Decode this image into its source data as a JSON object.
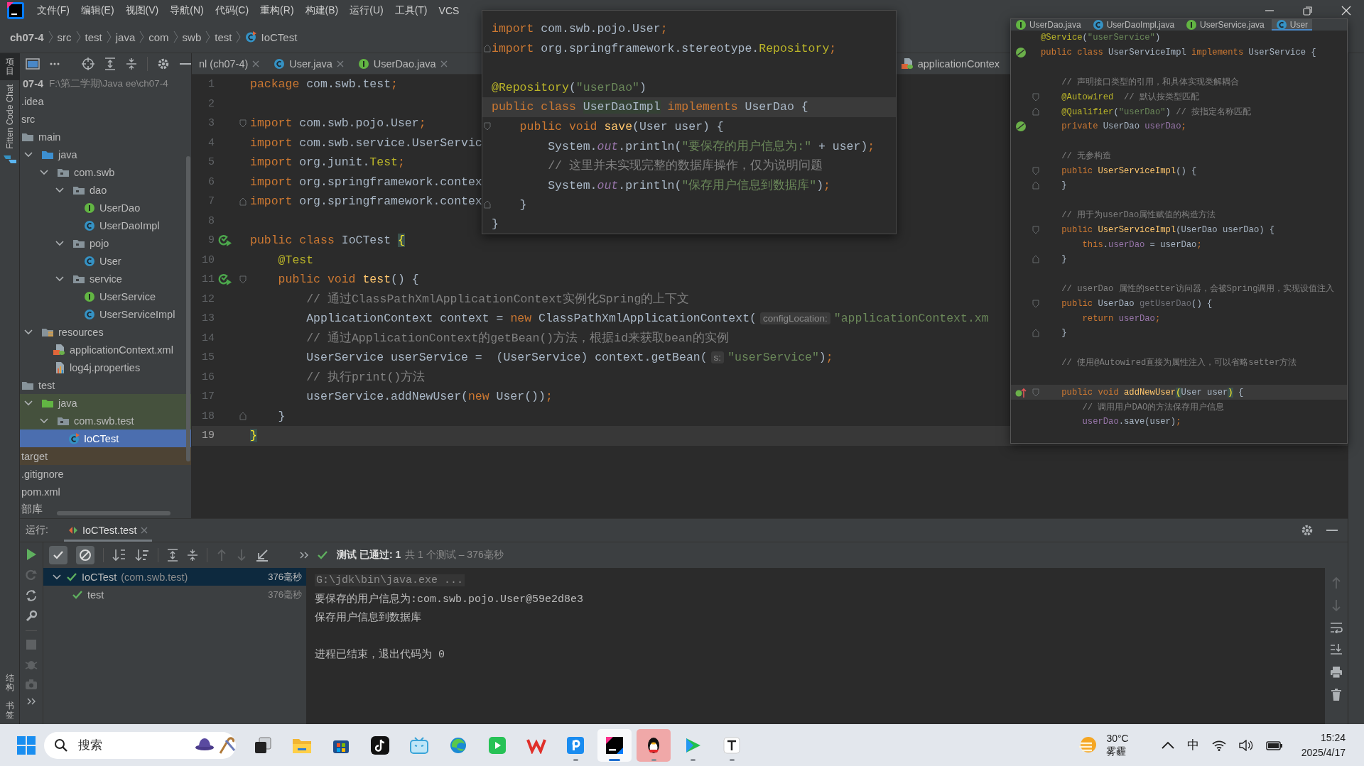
{
  "menu_bar": {
    "items": [
      "文件(F)",
      "编辑(E)",
      "视图(V)",
      "导航(N)",
      "代码(C)",
      "重构(R)",
      "构建(B)",
      "运行(U)",
      "工具(T)",
      "VCS"
    ]
  },
  "breadcrumb": {
    "items": [
      "ch07-4",
      "src",
      "test",
      "java",
      "com",
      "swb",
      "test",
      "IoCTest"
    ]
  },
  "tool_stripe": {
    "top": [
      {
        "label": "项目",
        "kind": "cjk",
        "selected": true
      },
      {
        "label": "Fitten Code Chat",
        "kind": "latin",
        "selected": false
      }
    ],
    "bottom": [
      {
        "label": "结构",
        "kind": "cjk",
        "selected": false
      },
      {
        "label": "书签",
        "kind": "cjk",
        "selected": false
      }
    ]
  },
  "project_panel": {
    "root_name": "07-4",
    "root_path": "F:\\第二学期\\Java ee\\ch07-4",
    "tree": [
      {
        "label": ".idea",
        "selected": false
      },
      {
        "label": "src",
        "selected": false,
        "children": [
          {
            "label": "main",
            "kind": "folder",
            "selected": false,
            "children": [
              {
                "label": "java",
                "kind": "source-folder",
                "expanded": true,
                "selected": false,
                "children": [
                  {
                    "label": "com.swb",
                    "kind": "package",
                    "expanded": true,
                    "selected": false,
                    "children": [
                      {
                        "label": "dao",
                        "kind": "package",
                        "expanded": true,
                        "selected": false,
                        "children": [
                          {
                            "label": "UserDao",
                            "kind": "interface",
                            "selected": false
                          },
                          {
                            "label": "UserDaoImpl",
                            "kind": "class",
                            "selected": false
                          }
                        ]
                      },
                      {
                        "label": "pojo",
                        "kind": "package",
                        "expanded": true,
                        "selected": false,
                        "children": [
                          {
                            "label": "User",
                            "kind": "class",
                            "selected": false
                          }
                        ]
                      },
                      {
                        "label": "service",
                        "kind": "package",
                        "expanded": true,
                        "selected": false,
                        "children": [
                          {
                            "label": "UserService",
                            "kind": "interface",
                            "selected": false
                          },
                          {
                            "label": "UserServiceImpl",
                            "kind": "class",
                            "selected": false
                          }
                        ]
                      }
                    ]
                  }
                ]
              },
              {
                "label": "resources",
                "kind": "resources",
                "expanded": true,
                "selected": false,
                "children": [
                  {
                    "label": "applicationContext.xml",
                    "kind": "xml",
                    "selected": false
                  },
                  {
                    "label": "log4j.properties",
                    "kind": "properties",
                    "selected": false
                  }
                ]
              }
            ]
          },
          {
            "label": "test",
            "kind": "folder",
            "selected": false,
            "children": [
              {
                "label": "java",
                "kind": "test-folder",
                "expanded": true,
                "color": "#45513d",
                "selected": false,
                "children": [
                  {
                    "label": "com.swb.test",
                    "kind": "package",
                    "expanded": true,
                    "color": "#45513d",
                    "selected": false,
                    "children": [
                      {
                        "label": "IoCTest",
                        "kind": "test-class",
                        "selected": true
                      }
                    ]
                  }
                ]
              }
            ]
          }
        ]
      },
      {
        "label": "target",
        "color": "#4d4334",
        "selected": false
      },
      {
        "label": ".gitignore",
        "selected": false
      },
      {
        "label": "pom.xml",
        "selected": false
      },
      {
        "label": "部库",
        "selected": false
      }
    ]
  },
  "editor": {
    "tabs": [
      {
        "label": "nl (ch07-4)",
        "kind": "none",
        "selected": false
      },
      {
        "label": "User.java",
        "kind": "class",
        "selected": false
      },
      {
        "label": "UserDao.java",
        "kind": "interface",
        "selected": false
      },
      {
        "label": "applicationContex",
        "kind": "xml",
        "selected": false
      }
    ],
    "lines": [
      {
        "number": "1",
        "current": false,
        "tokens": [
          {
            "kind": "keyword",
            "text": "package "
          },
          {
            "kind": "plain",
            "text": "com.swb.test"
          },
          {
            "kind": "keyword",
            "text": ";"
          }
        ]
      },
      {
        "number": "2",
        "current": false
      },
      {
        "number": "3",
        "current": false,
        "fold": {
          "kind": "start"
        },
        "tokens": [
          {
            "kind": "keyword",
            "text": "import "
          },
          {
            "kind": "plain",
            "text": "com.swb.pojo.User"
          },
          {
            "kind": "keyword",
            "text": ";"
          }
        ]
      },
      {
        "number": "4",
        "current": false,
        "tokens": [
          {
            "kind": "keyword",
            "text": "import "
          },
          {
            "kind": "plain",
            "text": "com.swb.service.UserServic"
          }
        ]
      },
      {
        "number": "5",
        "current": false,
        "tokens": [
          {
            "kind": "keyword",
            "text": "import "
          },
          {
            "kind": "plain",
            "text": "org.junit."
          },
          {
            "kind": "annotation",
            "text": "Test"
          },
          {
            "kind": "keyword",
            "text": ";"
          }
        ]
      },
      {
        "number": "6",
        "current": false,
        "tokens": [
          {
            "kind": "keyword",
            "text": "import "
          },
          {
            "kind": "plain",
            "text": "org.springframework.contex"
          }
        ]
      },
      {
        "number": "7",
        "current": false,
        "fold": {
          "kind": "end"
        },
        "tokens": [
          {
            "kind": "keyword",
            "text": "import "
          },
          {
            "kind": "plain",
            "text": "org.springframework.contex"
          }
        ]
      },
      {
        "number": "8",
        "current": false
      },
      {
        "number": "9",
        "current": false,
        "gutter": {
          "kind": "run"
        },
        "tokens": [
          {
            "kind": "keyword",
            "text": "public class "
          },
          {
            "kind": "plain",
            "text": "IoCTest "
          },
          {
            "kind": "brace",
            "text": "{"
          }
        ]
      },
      {
        "number": "10",
        "current": false,
        "tokens": [
          {
            "kind": "annotation",
            "text": "    @Test"
          }
        ]
      },
      {
        "number": "11",
        "current": false,
        "gutter": {
          "kind": "run"
        },
        "fold": {
          "kind": "start"
        },
        "tokens": [
          {
            "kind": "keyword",
            "text": "    public void "
          },
          {
            "kind": "method",
            "text": "test"
          },
          {
            "kind": "plain",
            "text": "() {"
          }
        ]
      },
      {
        "number": "12",
        "current": false,
        "tokens": [
          {
            "kind": "comment",
            "text": "        // 通过ClassPathXmlApplicationContext实例化Spring的上下文"
          }
        ]
      },
      {
        "number": "13",
        "current": false,
        "tokens": [
          {
            "kind": "plain",
            "text": "        ApplicationContext context = "
          },
          {
            "kind": "keyword",
            "text": "new "
          },
          {
            "kind": "plain",
            "text": "ClassPathXmlApplicationContext("
          },
          {
            "kind": "hint",
            "text": "configLocation:"
          },
          {
            "kind": "string",
            "text": "\"applicationContext.xm"
          }
        ]
      },
      {
        "number": "14",
        "current": false,
        "tokens": [
          {
            "kind": "comment",
            "text": "        // 通过ApplicationContext的getBean()方法，根据id来获取bean的实例"
          }
        ]
      },
      {
        "number": "15",
        "current": false,
        "tokens": [
          {
            "kind": "plain",
            "text": "        UserService userService =  (UserService) context.getBean("
          },
          {
            "kind": "hint",
            "text": "s:"
          },
          {
            "kind": "string",
            "text": "\"userService\""
          },
          {
            "kind": "plain",
            "text": ")"
          },
          {
            "kind": "keyword",
            "text": ";"
          }
        ]
      },
      {
        "number": "16",
        "current": false,
        "tokens": [
          {
            "kind": "comment",
            "text": "        // 执行print()方法"
          }
        ]
      },
      {
        "number": "17",
        "current": false,
        "tokens": [
          {
            "kind": "plain",
            "text": "        userService.addNewUser("
          },
          {
            "kind": "keyword",
            "text": "new "
          },
          {
            "kind": "plain",
            "text": "User())"
          },
          {
            "kind": "keyword",
            "text": ";"
          }
        ]
      },
      {
        "number": "18",
        "current": false,
        "fold": {
          "kind": "end"
        },
        "tokens": [
          {
            "kind": "plain",
            "text": "    }"
          }
        ]
      },
      {
        "number": "19",
        "current": true,
        "tokens": [
          {
            "kind": "brace",
            "text": "}"
          }
        ]
      }
    ]
  },
  "definition_popup": {
    "lines": [
      {
        "current": false,
        "tokens": [
          {
            "kind": "keyword",
            "text": "import "
          },
          {
            "kind": "plain",
            "text": "com.swb.pojo.User"
          },
          {
            "kind": "keyword",
            "text": ";"
          }
        ]
      },
      {
        "current": false,
        "fold": {
          "kind": "end"
        },
        "tokens": [
          {
            "kind": "keyword",
            "text": "import "
          },
          {
            "kind": "plain",
            "text": "org.springframework.stereotype."
          },
          {
            "kind": "annotation",
            "text": "Repository"
          },
          {
            "kind": "keyword",
            "text": ";"
          }
        ]
      },
      {
        "current": false
      },
      {
        "current": false,
        "tokens": [
          {
            "kind": "annotation",
            "text": "@Repository"
          },
          {
            "kind": "plain",
            "text": "("
          },
          {
            "kind": "string",
            "text": "\"userDao\""
          },
          {
            "kind": "plain",
            "text": ")"
          }
        ]
      },
      {
        "current": true,
        "tokens": [
          {
            "kind": "keyword",
            "text": "public class "
          },
          {
            "kind": "usage",
            "text": "UserDaoImpl"
          },
          {
            "kind": "keyword",
            "text": " implements "
          },
          {
            "kind": "plain",
            "text": "UserDao {"
          }
        ]
      },
      {
        "current": false,
        "fold": {
          "kind": "start"
        },
        "tokens": [
          {
            "kind": "keyword",
            "text": "    public void "
          },
          {
            "kind": "method",
            "text": "save"
          },
          {
            "kind": "plain",
            "text": "(User user) {"
          }
        ]
      },
      {
        "current": false,
        "tokens": [
          {
            "kind": "plain",
            "text": "        System."
          },
          {
            "kind": "static",
            "text": "out"
          },
          {
            "kind": "plain",
            "text": ".println("
          },
          {
            "kind": "string",
            "text": "\"要保存的用户信息为:\""
          },
          {
            "kind": "plain",
            "text": " + user)"
          },
          {
            "kind": "keyword",
            "text": ";"
          }
        ]
      },
      {
        "current": false,
        "tokens": [
          {
            "kind": "comment",
            "text": "        // 这里并未实现完整的数据库操作，仅为说明问题"
          }
        ]
      },
      {
        "current": false,
        "tokens": [
          {
            "kind": "plain",
            "text": "        System."
          },
          {
            "kind": "static",
            "text": "out"
          },
          {
            "kind": "plain",
            "text": ".println("
          },
          {
            "kind": "string",
            "text": "\"保存用户信息到数据库\""
          },
          {
            "kind": "plain",
            "text": ")"
          },
          {
            "kind": "keyword",
            "text": ";"
          }
        ]
      },
      {
        "current": false,
        "fold": {
          "kind": "end"
        },
        "tokens": [
          {
            "kind": "plain",
            "text": "    }"
          }
        ]
      },
      {
        "current": false,
        "tokens": [
          {
            "kind": "plain",
            "text": "}"
          }
        ]
      }
    ]
  },
  "side_window": {
    "tabs": [
      {
        "label": "UserDao.java",
        "kind": "interface",
        "selected": false
      },
      {
        "label": "UserDaoImpl.java",
        "kind": "class",
        "selected": false
      },
      {
        "label": "UserService.java",
        "kind": "interface",
        "selected": false
      },
      {
        "label": "User",
        "kind": "class",
        "selected": true
      }
    ],
    "lines": [
      {
        "current": false,
        "tokens": [
          {
            "kind": "annotation",
            "text": "@Service"
          },
          {
            "kind": "plain",
            "text": "("
          },
          {
            "kind": "string",
            "text": "\"userService\""
          },
          {
            "kind": "plain",
            "text": ")"
          }
        ]
      },
      {
        "current": false,
        "gutter": {
          "kind": "bean"
        },
        "tokens": [
          {
            "kind": "keyword",
            "text": "public class "
          },
          {
            "kind": "plain",
            "text": "UserServiceImpl "
          },
          {
            "kind": "keyword",
            "text": "implements "
          },
          {
            "kind": "plain",
            "text": "UserService {"
          }
        ]
      },
      {
        "current": false
      },
      {
        "current": false,
        "tokens": [
          {
            "kind": "comment",
            "text": "    // 声明接口类型的引用，和具体实现类解耦合"
          }
        ]
      },
      {
        "current": false,
        "fold": {
          "kind": "start"
        },
        "tokens": [
          {
            "kind": "annotation",
            "text": "    @Autowired"
          },
          {
            "kind": "comment",
            "text": "  // 默认按类型匹配"
          }
        ]
      },
      {
        "current": false,
        "fold": {
          "kind": "end"
        },
        "tokens": [
          {
            "kind": "annotation",
            "text": "    @Qualifier"
          },
          {
            "kind": "plain",
            "text": "("
          },
          {
            "kind": "string",
            "text": "\"userDao\""
          },
          {
            "kind": "plain",
            "text": ")"
          },
          {
            "kind": "comment",
            "text": " // 按指定名称匹配"
          }
        ]
      },
      {
        "current": false,
        "gutter": {
          "kind": "bean"
        },
        "tokens": [
          {
            "kind": "keyword",
            "text": "    private "
          },
          {
            "kind": "plain",
            "text": "UserDao "
          },
          {
            "kind": "field",
            "text": "userDao"
          },
          {
            "kind": "keyword",
            "text": ";"
          }
        ]
      },
      {
        "current": false
      },
      {
        "current": false,
        "tokens": [
          {
            "kind": "comment",
            "text": "    // 无参构造"
          }
        ]
      },
      {
        "current": false,
        "fold": {
          "kind": "start"
        },
        "tokens": [
          {
            "kind": "keyword",
            "text": "    public "
          },
          {
            "kind": "method",
            "text": "UserServiceImpl"
          },
          {
            "kind": "plain",
            "text": "() {"
          }
        ]
      },
      {
        "current": false,
        "fold": {
          "kind": "end"
        },
        "tokens": [
          {
            "kind": "plain",
            "text": "    }"
          }
        ]
      },
      {
        "current": false
      },
      {
        "current": false,
        "tokens": [
          {
            "kind": "comment",
            "text": "    // 用于为userDao属性赋值的构造方法"
          }
        ]
      },
      {
        "current": false,
        "fold": {
          "kind": "start"
        },
        "tokens": [
          {
            "kind": "keyword",
            "text": "    public "
          },
          {
            "kind": "method",
            "text": "UserServiceImpl"
          },
          {
            "kind": "plain",
            "text": "(UserDao userDao) {"
          }
        ]
      },
      {
        "current": false,
        "tokens": [
          {
            "kind": "keyword",
            "text": "        this"
          },
          {
            "kind": "plain",
            "text": "."
          },
          {
            "kind": "field",
            "text": "userDao"
          },
          {
            "kind": "plain",
            "text": " = userDao"
          },
          {
            "kind": "keyword",
            "text": ";"
          }
        ]
      },
      {
        "current": false,
        "fold": {
          "kind": "end"
        },
        "tokens": [
          {
            "kind": "plain",
            "text": "    }"
          }
        ]
      },
      {
        "current": false
      },
      {
        "current": false,
        "tokens": [
          {
            "kind": "comment",
            "text": "    // userDao 属性的setter访问器，会被Spring调用，实现设值注入"
          }
        ]
      },
      {
        "current": false,
        "fold": {
          "kind": "start"
        },
        "tokens": [
          {
            "kind": "keyword",
            "text": "    public "
          },
          {
            "kind": "plain",
            "text": "UserDao "
          },
          {
            "kind": "unused",
            "text": "getUserDao"
          },
          {
            "kind": "plain",
            "text": "() {"
          }
        ]
      },
      {
        "current": false,
        "tokens": [
          {
            "kind": "keyword",
            "text": "        return "
          },
          {
            "kind": "field",
            "text": "userDao"
          },
          {
            "kind": "keyword",
            "text": ";"
          }
        ]
      },
      {
        "current": false,
        "fold": {
          "kind": "end"
        },
        "tokens": [
          {
            "kind": "plain",
            "text": "    }"
          }
        ]
      },
      {
        "current": false
      },
      {
        "current": false,
        "tokens": [
          {
            "kind": "comment",
            "text": "    // 使用@Autowired直接为属性注入，可以省略setter方法"
          }
        ]
      },
      {
        "current": false
      },
      {
        "current": true,
        "gutter": {
          "kind": "override"
        },
        "fold": {
          "kind": "start"
        },
        "tokens": [
          {
            "kind": "keyword",
            "text": "    public void "
          },
          {
            "kind": "method",
            "text": "addNewUser"
          },
          {
            "kind": "brace",
            "text": "("
          },
          {
            "kind": "plain",
            "text": "User user"
          },
          {
            "kind": "brace",
            "text": ")"
          },
          {
            "kind": "plain",
            "text": " {"
          }
        ]
      },
      {
        "current": false,
        "tokens": [
          {
            "kind": "comment",
            "text": "        // 调用用户DAO的方法保存用户信息"
          }
        ]
      },
      {
        "current": false,
        "tokens": [
          {
            "kind": "field",
            "text": "        userDao"
          },
          {
            "kind": "plain",
            "text": ".save(user)"
          },
          {
            "kind": "keyword",
            "text": ";"
          }
        ]
      }
    ]
  },
  "run_panel": {
    "label": "运行:",
    "tab": "IoCTest.test",
    "show_passed": true,
    "show_ignored": true,
    "status": "**测试 已通过: 1**共 1 个测试 – 376毫秒",
    "tests": [
      {
        "name": "IoCTest",
        "package": "(com.swb.test)",
        "time": "376毫秒",
        "passed": true,
        "expanded": true,
        "selected": true,
        "children": [
          {
            "name": "test",
            "time": "376毫秒",
            "passed": true,
            "selected": false
          }
        ]
      }
    ],
    "console": [
      {
        "kind": "command",
        "text": "G:\\jdk\\bin\\java.exe ..."
      },
      {
        "kind": "output",
        "text": "要保存的用户信息为:com.swb.pojo.User@59e2d8e3"
      },
      {
        "kind": "output",
        "text": "保存用户信息到数据库"
      },
      {
        "kind": "exit",
        "text": "进程已结束，退出代码为 0"
      }
    ]
  },
  "taskbar": {
    "search_placeholder": "搜索",
    "apps": [
      {
        "kind": "task-view",
        "running": false,
        "active": false,
        "flashing": false
      },
      {
        "kind": "explorer",
        "running": false,
        "active": false,
        "flashing": false
      },
      {
        "kind": "store",
        "running": false,
        "active": false,
        "flashing": false
      },
      {
        "kind": "tiktok",
        "running": false,
        "active": false,
        "flashing": false
      },
      {
        "kind": "bilibili",
        "running": false,
        "active": false,
        "flashing": false
      },
      {
        "kind": "edge",
        "running": false,
        "active": false,
        "flashing": false
      },
      {
        "kind": "iqiyi",
        "running": false,
        "active": false,
        "flashing": false
      },
      {
        "kind": "wps",
        "running": false,
        "active": false,
        "flashing": false
      },
      {
        "kind": "p-app",
        "running": true,
        "active": false,
        "flashing": false
      },
      {
        "kind": "intellij",
        "running": true,
        "active": true,
        "flashing": false
      },
      {
        "kind": "qq",
        "running": true,
        "active": false,
        "flashing": true
      },
      {
        "kind": "player",
        "running": true,
        "active": false,
        "flashing": false
      },
      {
        "kind": "typora",
        "running": true,
        "active": false,
        "flashing": false
      }
    ],
    "weather": {
      "temperature": "30°C",
      "condition": "雾霾"
    },
    "ime": "中",
    "time": "15:24",
    "date": "2025/4/17"
  }
}
